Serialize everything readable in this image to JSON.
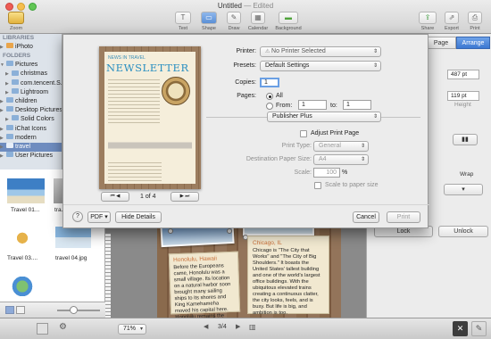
{
  "window": {
    "title": "Untitled",
    "status": "Edited"
  },
  "toolbar": {
    "left": [
      {
        "label": "Zoom",
        "icon": "zoom-icon"
      }
    ],
    "center": [
      {
        "label": "Text",
        "icon": "text-icon",
        "glyph": "T"
      },
      {
        "label": "Shape",
        "icon": "shape-icon",
        "glyph": "▭"
      },
      {
        "label": "Draw",
        "icon": "pen-icon",
        "glyph": "✎"
      },
      {
        "label": "Calendar",
        "icon": "calendar-icon",
        "glyph": "▦"
      },
      {
        "label": "Background",
        "icon": "background-icon",
        "glyph": "▬"
      }
    ],
    "right": [
      {
        "label": "Share",
        "icon": "share-icon",
        "glyph": "⇪"
      },
      {
        "label": "Export",
        "icon": "export-icon",
        "glyph": "⇗"
      },
      {
        "label": "Print",
        "icon": "print-icon",
        "glyph": "⎙"
      }
    ]
  },
  "sidebar": {
    "libraries_header": "LIBRARIES",
    "libraries": [
      {
        "label": "iPhoto",
        "icon": "iphoto-icon"
      }
    ],
    "folders_header": "FOLDERS",
    "folders": [
      {
        "label": "Pictures",
        "depth": 0,
        "open": true,
        "selected": false
      },
      {
        "label": "christmas",
        "depth": 1,
        "open": false,
        "selected": false
      },
      {
        "label": "com.tencent.S...",
        "depth": 1,
        "open": false,
        "selected": false
      },
      {
        "label": "Lightroom",
        "depth": 1,
        "open": false,
        "selected": false
      },
      {
        "label": "children",
        "depth": 0,
        "open": false,
        "selected": false
      },
      {
        "label": "Desktop Pictures",
        "depth": 0,
        "open": false,
        "selected": false
      },
      {
        "label": "Solid Colors",
        "depth": 1,
        "open": false,
        "selected": false
      },
      {
        "label": "iChat Icons",
        "depth": 0,
        "open": false,
        "selected": false
      },
      {
        "label": "modern",
        "depth": 0,
        "open": false,
        "selected": false
      },
      {
        "label": "travel",
        "depth": 0,
        "open": false,
        "selected": true
      },
      {
        "label": "User Pictures",
        "depth": 0,
        "open": false,
        "selected": false
      }
    ]
  },
  "browser": {
    "items": [
      {
        "label": "Travel 01..."
      },
      {
        "label": "tra..."
      },
      {
        "label": "Travel 03...."
      },
      {
        "label": "travel 04.jpg"
      }
    ]
  },
  "print_dialog": {
    "printer_label": "Printer:",
    "printer_value": "No Printer Selected",
    "presets_label": "Presets:",
    "presets_value": "Default Settings",
    "copies_label": "Copies:",
    "copies_value": "1",
    "pages_label": "Pages:",
    "pages_all": "All",
    "pages_from": "From:",
    "from_value": "1",
    "pages_to": "to:",
    "to_value": "1",
    "app_section": "Publisher Plus",
    "adjust_label": "Adjust Print Page",
    "print_type_label": "Print Type:",
    "print_type_value": "General",
    "paper_size_label": "Destination Paper Size:",
    "paper_size_value": "A4",
    "scale_label": "Scale:",
    "scale_value": "100",
    "scale_unit": "%",
    "scale_to_paper": "Scale to paper size",
    "page_indicator": "1 of 4",
    "help": "?",
    "pdf": "PDF",
    "hide_details": "Hide Details",
    "cancel": "Cancel",
    "print": "Print",
    "preview": {
      "newsletter_title": "NEWSLETTER",
      "masthead": "NEWS IN TRAVEL"
    }
  },
  "inspector": {
    "tabs": [
      "Page",
      "Arrange"
    ],
    "width_value": "487 pt",
    "height_value": "119 pt",
    "height_label": "Height",
    "text_wrap": "Wrap",
    "lock": "Lock",
    "unlock": "Unlock"
  },
  "canvas": {
    "card1": {
      "title": "Honolulu, Hawaii",
      "body": "Before the Europeans came, Honolulu was a small village. Its location on a natural harbor soon brought many sailing ships to its shores and King Kamehameha moved his capital here. Honolulu remains the economic center of the archipelago."
    },
    "card2": {
      "title": "Chicago, IL",
      "body": "Chicago is \"The City that Works\" and \"The City of Big Shoulders.\" It boasts the United States' tallest building and one of the world's largest office buildings. With the ubiquitous elevated trains creating a continuous clatter, the city looks, feels, and is busy. But life is big, and ambition is too."
    }
  },
  "bottombar": {
    "zoom_value": "71%",
    "page_current": "3/4"
  }
}
